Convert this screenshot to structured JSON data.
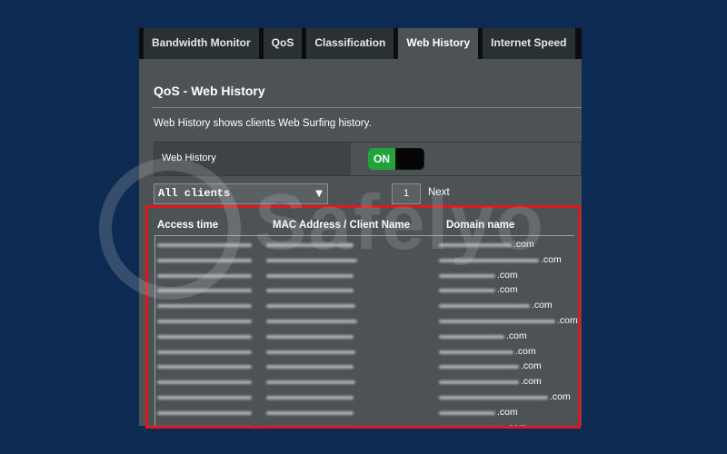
{
  "tabs": [
    {
      "label": "Bandwidth Monitor",
      "active": false
    },
    {
      "label": "QoS",
      "active": false
    },
    {
      "label": "Classification",
      "active": false
    },
    {
      "label": "Web History",
      "active": true
    },
    {
      "label": "Internet Speed",
      "active": false
    }
  ],
  "page": {
    "title": "QoS - Web History",
    "description": "Web History shows clients Web Surfing history."
  },
  "setting": {
    "label": "Web History",
    "toggle_state": "ON"
  },
  "filter": {
    "client_select": "All clients",
    "page_number": "1",
    "next_label": "Next"
  },
  "table": {
    "columns": [
      "Access time",
      "MAC Address / Client Name",
      "Domain name"
    ],
    "rows": [
      {
        "domain_suffix": ".com"
      },
      {
        "domain_suffix": ".com"
      },
      {
        "domain_suffix": ".com"
      },
      {
        "domain_suffix": ".com"
      },
      {
        "domain_suffix": ".com"
      },
      {
        "domain_suffix": ".com"
      },
      {
        "domain_suffix": ".com"
      },
      {
        "domain_suffix": ".com"
      },
      {
        "domain_suffix": ".com"
      },
      {
        "domain_suffix": ".com"
      },
      {
        "domain_suffix": ".com"
      },
      {
        "domain_suffix": ".com"
      },
      {
        "domain_suffix": ".com"
      }
    ]
  },
  "watermark": {
    "text": "Safelyo"
  },
  "colors": {
    "page_bg": "#0d2a52",
    "panel_bg": "#4d5254",
    "toggle_on": "#21a23a",
    "highlight_border": "#e0171c"
  }
}
